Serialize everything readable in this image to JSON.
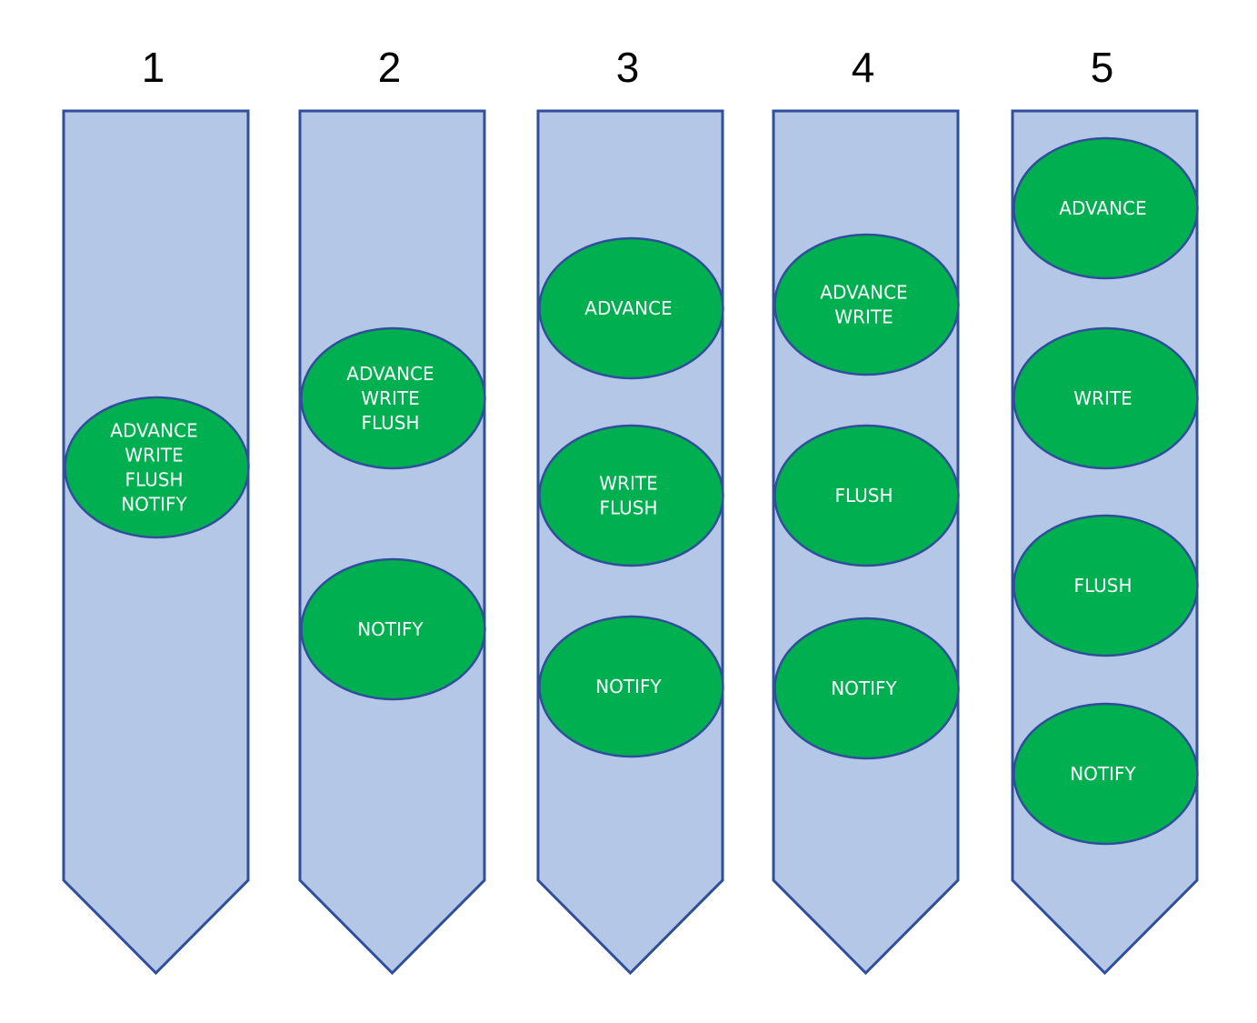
{
  "colors": {
    "column_fill": "#b4c7e7",
    "column_stroke": "#2f4f9a",
    "ellipse_fill": "#00b050",
    "ellipse_stroke": "#2f4f9a",
    "text": "#ffffff"
  },
  "columns": [
    {
      "label": "1",
      "steps": [
        [
          "ADVANCE",
          "WRITE",
          "FLUSH",
          "NOTIFY"
        ]
      ]
    },
    {
      "label": "2",
      "steps": [
        [
          "ADVANCE",
          "WRITE",
          "FLUSH"
        ],
        [
          "NOTIFY"
        ]
      ]
    },
    {
      "label": "3",
      "steps": [
        [
          "ADVANCE"
        ],
        [
          "WRITE",
          "FLUSH"
        ],
        [
          "NOTIFY"
        ]
      ]
    },
    {
      "label": "4",
      "steps": [
        [
          "ADVANCE",
          "WRITE"
        ],
        [
          "FLUSH"
        ],
        [
          "NOTIFY"
        ]
      ]
    },
    {
      "label": "5",
      "steps": [
        [
          "ADVANCE"
        ],
        [
          "WRITE"
        ],
        [
          "FLUSH"
        ],
        [
          "NOTIFY"
        ]
      ]
    }
  ]
}
